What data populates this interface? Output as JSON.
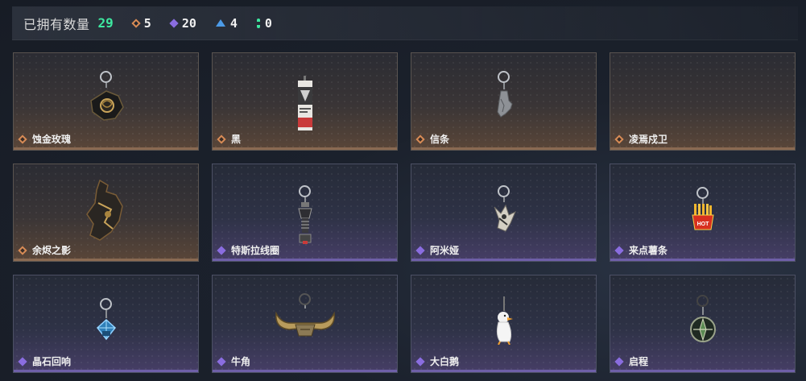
{
  "header": {
    "owned_label": "已拥有数量",
    "owned_count": "29",
    "rarity_counts": [
      {
        "icon": "orange-diamond-icon",
        "value": "5",
        "color": "#d98c56"
      },
      {
        "icon": "purple-diamond-icon",
        "value": "20",
        "color": "#8a6de0"
      },
      {
        "icon": "blue-triangle-icon",
        "value": "4",
        "color": "#4c9be8"
      },
      {
        "icon": "green-bar-icon",
        "value": "0",
        "color": "#3ee8a0"
      }
    ]
  },
  "items": [
    {
      "name": "蚀金玫瑰",
      "rarity": "orange",
      "art": "black-rose-pendant"
    },
    {
      "name": "黑",
      "rarity": "orange",
      "art": "tag-pendant"
    },
    {
      "name": "信条",
      "rarity": "orange",
      "art": "hand-pendant"
    },
    {
      "name": "凌焉戍卫",
      "rarity": "orange",
      "art": "empty"
    },
    {
      "name": "余烬之影",
      "rarity": "orange",
      "art": "ember-shadow-pendant"
    },
    {
      "name": "特斯拉线圈",
      "rarity": "purple",
      "art": "coil-pendant"
    },
    {
      "name": "阿米娅",
      "rarity": "purple",
      "art": "figure-pendant"
    },
    {
      "name": "来点薯条",
      "rarity": "purple",
      "art": "fries-pendant"
    },
    {
      "name": "晶石回响",
      "rarity": "purple",
      "art": "crystal-pendant"
    },
    {
      "name": "牛角",
      "rarity": "purple",
      "art": "horns-pendant"
    },
    {
      "name": "大白鹅",
      "rarity": "purple",
      "art": "goose-pendant"
    },
    {
      "name": "启程",
      "rarity": "purple",
      "art": "compass-pendant"
    }
  ]
}
